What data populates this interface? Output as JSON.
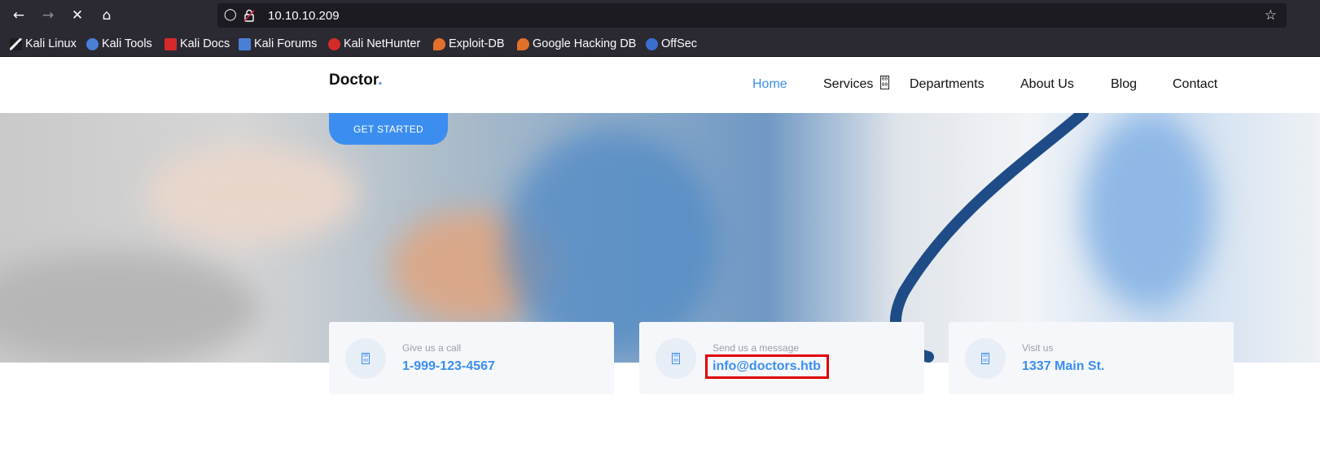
{
  "browser": {
    "url": "10.10.10.209",
    "bookmarks": [
      {
        "label": "Kali Linux",
        "icon": "kali-dragon-icon",
        "color": "#e8e8e8"
      },
      {
        "label": "Kali Tools",
        "icon": "kali-tools-icon",
        "color": "#4a7fd8"
      },
      {
        "label": "Kali Docs",
        "icon": "kali-docs-icon",
        "color": "#d42a2a"
      },
      {
        "label": "Kali Forums",
        "icon": "kali-forums-icon",
        "color": "#4a7fd8"
      },
      {
        "label": "Kali NetHunter",
        "icon": "kali-nethunter-icon",
        "color": "#d42a2a"
      },
      {
        "label": "Exploit-DB",
        "icon": "exploit-db-icon",
        "color": "#e3702a"
      },
      {
        "label": "Google Hacking DB",
        "icon": "ghdb-icon",
        "color": "#e3702a"
      },
      {
        "label": "OffSec",
        "icon": "offsec-icon",
        "color": "#3a6fd0"
      }
    ]
  },
  "site": {
    "logo_text": "Doctor",
    "logo_dot": ".",
    "nav": {
      "home": "Home",
      "services": "Services",
      "departments": "Departments",
      "about": "About Us",
      "blog": "Blog",
      "contact": "Contact"
    },
    "hero_button": "GET STARTED",
    "cards": [
      {
        "label": "Give us a call",
        "value": "1-999-123-4567"
      },
      {
        "label": "Send us a message",
        "value": "info@doctors.htb"
      },
      {
        "label": "Visit us",
        "value": "1337 Main St."
      }
    ],
    "accent_color": "#3b8ef0",
    "highlight_color": "#e00000"
  }
}
